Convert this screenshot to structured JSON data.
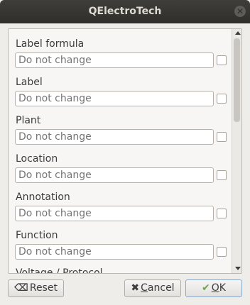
{
  "window": {
    "title": "QElectroTech"
  },
  "fields": [
    {
      "label": "Label formula",
      "placeholder": "Do not change"
    },
    {
      "label": "Label",
      "placeholder": "Do not change"
    },
    {
      "label": "Plant",
      "placeholder": "Do not change"
    },
    {
      "label": "Location",
      "placeholder": "Do not change"
    },
    {
      "label": "Annotation",
      "placeholder": "Do not change"
    },
    {
      "label": "Function",
      "placeholder": "Do not change"
    }
  ],
  "partial_field": {
    "label": "Voltage / Protocol"
  },
  "buttons": {
    "reset": "Reset",
    "cancel_underlined": "C",
    "cancel_rest": "ancel",
    "ok_underlined": "O",
    "ok_rest": "K"
  },
  "icons": {
    "close": "close-icon",
    "reset": "backspace-icon",
    "cancel": "x-icon",
    "ok": "checkmark-icon"
  },
  "colors": {
    "titlebar": "#2f2e2b",
    "ok_check": "#6aa84f",
    "cancel_x": "#3c3c3c"
  }
}
